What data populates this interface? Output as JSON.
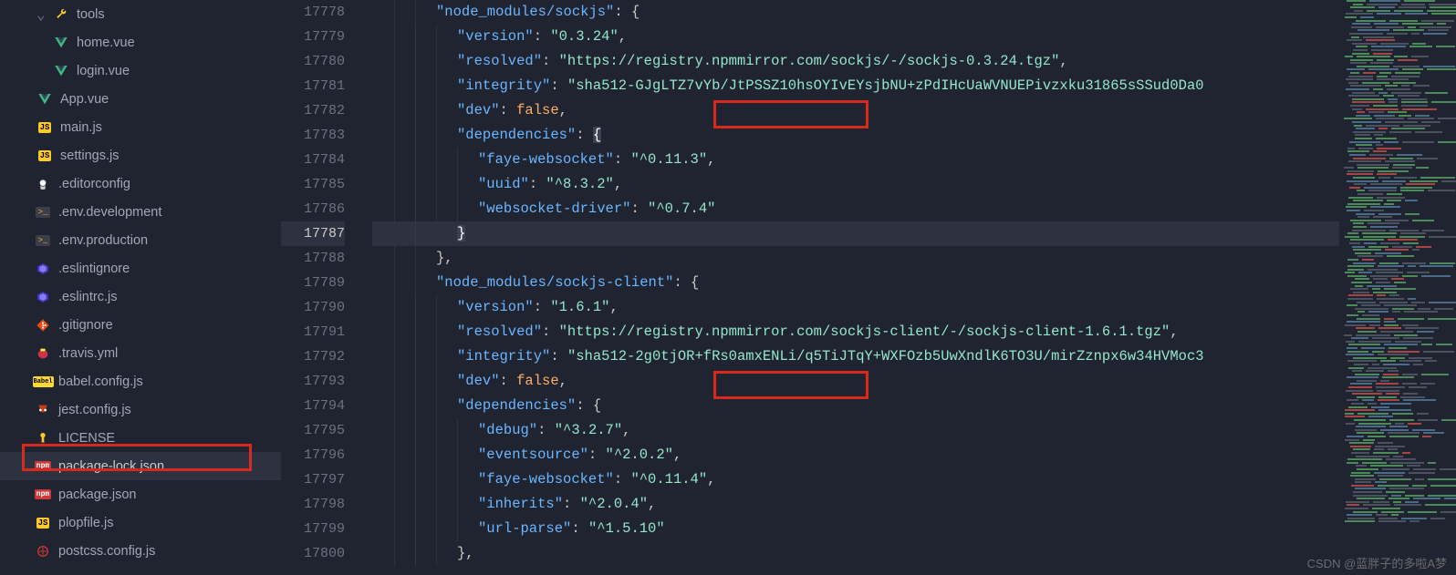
{
  "sidebar": {
    "items": [
      {
        "name": "tools",
        "icon": "tools",
        "indent": "indent-0",
        "has_chevron": true
      },
      {
        "name": "home.vue",
        "icon": "vue",
        "indent": "indent-1"
      },
      {
        "name": "login.vue",
        "icon": "vue",
        "indent": "indent-1"
      },
      {
        "name": "App.vue",
        "icon": "vue",
        "indent": "indent-0"
      },
      {
        "name": "main.js",
        "icon": "js",
        "indent": "indent-0"
      },
      {
        "name": "settings.js",
        "icon": "js",
        "indent": "indent-0"
      },
      {
        "name": ".editorconfig",
        "icon": "editorconfig",
        "indent": "indent-r"
      },
      {
        "name": ".env.development",
        "icon": "env",
        "indent": "indent-r"
      },
      {
        "name": ".env.production",
        "icon": "env",
        "indent": "indent-r"
      },
      {
        "name": ".eslintignore",
        "icon": "eslint",
        "indent": "indent-r"
      },
      {
        "name": ".eslintrc.js",
        "icon": "eslint",
        "indent": "indent-r"
      },
      {
        "name": ".gitignore",
        "icon": "git",
        "indent": "indent-r"
      },
      {
        "name": ".travis.yml",
        "icon": "travis",
        "indent": "indent-r"
      },
      {
        "name": "babel.config.js",
        "icon": "babel",
        "indent": "indent-r"
      },
      {
        "name": "jest.config.js",
        "icon": "jest",
        "indent": "indent-r"
      },
      {
        "name": "LICENSE",
        "icon": "license",
        "indent": "indent-r"
      },
      {
        "name": "package-lock.json",
        "icon": "npm",
        "indent": "indent-r",
        "active": true
      },
      {
        "name": "package.json",
        "icon": "npm",
        "indent": "indent-r"
      },
      {
        "name": "plopfile.js",
        "icon": "js",
        "indent": "indent-r"
      },
      {
        "name": "postcss.config.js",
        "icon": "postcss",
        "indent": "indent-r"
      }
    ]
  },
  "editor": {
    "line_start": 17778,
    "current_line": 17787,
    "lines": [
      {
        "n": 17778,
        "indent": 2,
        "tokens": [
          {
            "t": "key",
            "v": "\"node_modules/sockjs\""
          },
          {
            "t": "punc",
            "v": ": {"
          }
        ]
      },
      {
        "n": 17779,
        "indent": 3,
        "tokens": [
          {
            "t": "key",
            "v": "\"version\""
          },
          {
            "t": "punc",
            "v": ": "
          },
          {
            "t": "str",
            "v": "\"0.3.24\""
          },
          {
            "t": "punc",
            "v": ","
          }
        ]
      },
      {
        "n": 17780,
        "indent": 3,
        "tokens": [
          {
            "t": "key",
            "v": "\"resolved\""
          },
          {
            "t": "punc",
            "v": ": "
          },
          {
            "t": "str",
            "v": "\"https://registry.npmmirror.com/sockjs/-/sockjs-0.3.24.tgz\""
          },
          {
            "t": "punc",
            "v": ","
          }
        ]
      },
      {
        "n": 17781,
        "indent": 3,
        "tokens": [
          {
            "t": "key",
            "v": "\"integrity\""
          },
          {
            "t": "punc",
            "v": ": "
          },
          {
            "t": "str",
            "v": "\"sha512-GJgLTZ7vYb/JtPSSZ10hsOYIvEYsjbNU+zPdIHcUaWVNUEPivzxku31865sSSud0Da0"
          }
        ]
      },
      {
        "n": 17782,
        "indent": 3,
        "tokens": [
          {
            "t": "key",
            "v": "\"dev\""
          },
          {
            "t": "punc",
            "v": ": "
          },
          {
            "t": "kw",
            "v": "false"
          },
          {
            "t": "punc",
            "v": ","
          }
        ]
      },
      {
        "n": 17783,
        "indent": 3,
        "tokens": [
          {
            "t": "key",
            "v": "\"dependencies\""
          },
          {
            "t": "punc",
            "v": ": "
          },
          {
            "t": "brace",
            "v": "{",
            "hl": true
          }
        ]
      },
      {
        "n": 17784,
        "indent": 4,
        "tokens": [
          {
            "t": "key",
            "v": "\"faye-websocket\""
          },
          {
            "t": "punc",
            "v": ": "
          },
          {
            "t": "str",
            "v": "\"^0.11.3\""
          },
          {
            "t": "punc",
            "v": ","
          }
        ]
      },
      {
        "n": 17785,
        "indent": 4,
        "tokens": [
          {
            "t": "key",
            "v": "\"uuid\""
          },
          {
            "t": "punc",
            "v": ": "
          },
          {
            "t": "str",
            "v": "\"^8.3.2\""
          },
          {
            "t": "punc",
            "v": ","
          }
        ]
      },
      {
        "n": 17786,
        "indent": 4,
        "tokens": [
          {
            "t": "key",
            "v": "\"websocket-driver\""
          },
          {
            "t": "punc",
            "v": ": "
          },
          {
            "t": "str",
            "v": "\"^0.7.4\""
          }
        ]
      },
      {
        "n": 17787,
        "indent": 3,
        "tokens": [
          {
            "t": "brace",
            "v": "}",
            "hl": true
          }
        ],
        "current": true
      },
      {
        "n": 17788,
        "indent": 2,
        "tokens": [
          {
            "t": "punc",
            "v": "},"
          }
        ]
      },
      {
        "n": 17789,
        "indent": 2,
        "tokens": [
          {
            "t": "key",
            "v": "\"node_modules/sockjs-client\""
          },
          {
            "t": "punc",
            "v": ": {"
          }
        ]
      },
      {
        "n": 17790,
        "indent": 3,
        "tokens": [
          {
            "t": "key",
            "v": "\"version\""
          },
          {
            "t": "punc",
            "v": ": "
          },
          {
            "t": "str",
            "v": "\"1.6.1\""
          },
          {
            "t": "punc",
            "v": ","
          }
        ]
      },
      {
        "n": 17791,
        "indent": 3,
        "tokens": [
          {
            "t": "key",
            "v": "\"resolved\""
          },
          {
            "t": "punc",
            "v": ": "
          },
          {
            "t": "str",
            "v": "\"https://registry.npmmirror.com/sockjs-client/-/sockjs-client-1.6.1.tgz\""
          },
          {
            "t": "punc",
            "v": ","
          }
        ]
      },
      {
        "n": 17792,
        "indent": 3,
        "tokens": [
          {
            "t": "key",
            "v": "\"integrity\""
          },
          {
            "t": "punc",
            "v": ": "
          },
          {
            "t": "str",
            "v": "\"sha512-2g0tjOR+fRs0amxENLi/q5TiJTqY+WXFOzb5UwXndlK6TO3U/mirZznpx6w34HVMoc3"
          }
        ]
      },
      {
        "n": 17793,
        "indent": 3,
        "tokens": [
          {
            "t": "key",
            "v": "\"dev\""
          },
          {
            "t": "punc",
            "v": ": "
          },
          {
            "t": "kw",
            "v": "false"
          },
          {
            "t": "punc",
            "v": ","
          }
        ]
      },
      {
        "n": 17794,
        "indent": 3,
        "tokens": [
          {
            "t": "key",
            "v": "\"dependencies\""
          },
          {
            "t": "punc",
            "v": ": {"
          }
        ]
      },
      {
        "n": 17795,
        "indent": 4,
        "tokens": [
          {
            "t": "key",
            "v": "\"debug\""
          },
          {
            "t": "punc",
            "v": ": "
          },
          {
            "t": "str",
            "v": "\"^3.2.7\""
          },
          {
            "t": "punc",
            "v": ","
          }
        ]
      },
      {
        "n": 17796,
        "indent": 4,
        "tokens": [
          {
            "t": "key",
            "v": "\"eventsource\""
          },
          {
            "t": "punc",
            "v": ": "
          },
          {
            "t": "str",
            "v": "\"^2.0.2\""
          },
          {
            "t": "punc",
            "v": ","
          }
        ]
      },
      {
        "n": 17797,
        "indent": 4,
        "tokens": [
          {
            "t": "key",
            "v": "\"faye-websocket\""
          },
          {
            "t": "punc",
            "v": ": "
          },
          {
            "t": "str",
            "v": "\"^0.11.4\""
          },
          {
            "t": "punc",
            "v": ","
          }
        ]
      },
      {
        "n": 17798,
        "indent": 4,
        "tokens": [
          {
            "t": "key",
            "v": "\"inherits\""
          },
          {
            "t": "punc",
            "v": ": "
          },
          {
            "t": "str",
            "v": "\"^2.0.4\""
          },
          {
            "t": "punc",
            "v": ","
          }
        ]
      },
      {
        "n": 17799,
        "indent": 4,
        "tokens": [
          {
            "t": "key",
            "v": "\"url-parse\""
          },
          {
            "t": "punc",
            "v": ": "
          },
          {
            "t": "str",
            "v": "\"^1.5.10\""
          }
        ]
      },
      {
        "n": 17800,
        "indent": 3,
        "tokens": [
          {
            "t": "punc",
            "v": "},"
          }
        ]
      }
    ]
  },
  "watermark": "CSDN @蓝胖子的多啦A梦"
}
